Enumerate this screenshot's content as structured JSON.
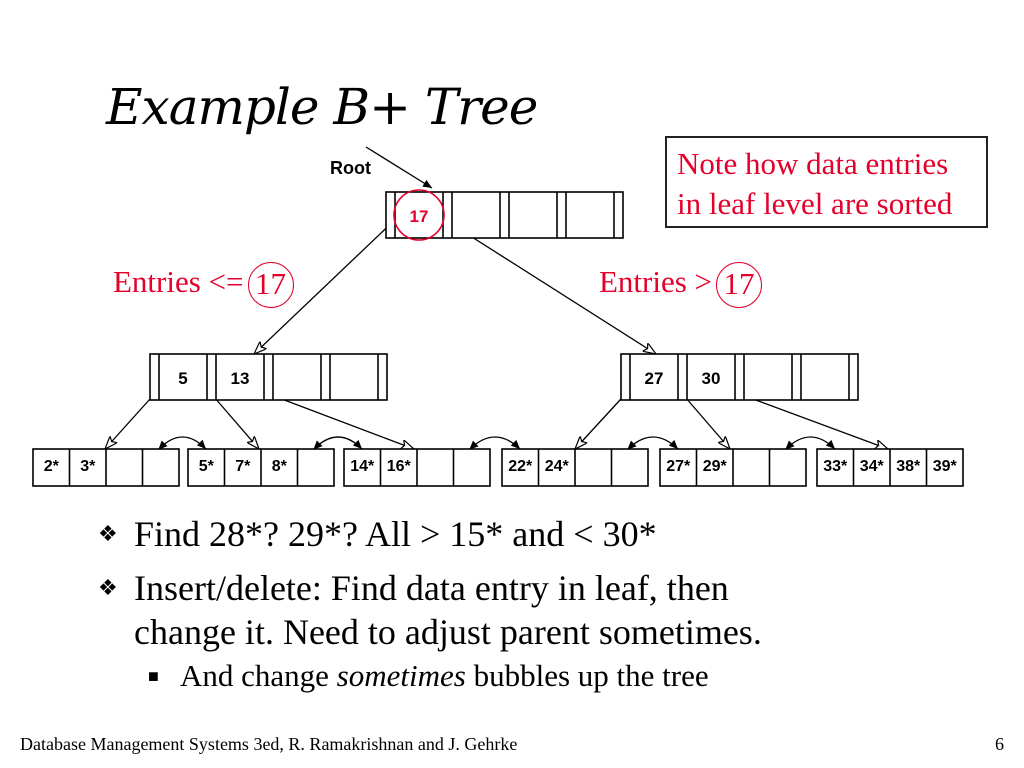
{
  "slide": {
    "title": "Example B+ Tree",
    "note_lines": [
      "Note how data entries",
      "in leaf level are sorted"
    ],
    "root_label": "Root",
    "entries_left": {
      "text": "Entries <=",
      "key": "17"
    },
    "entries_right": {
      "text": "Entries >",
      "key": "17"
    },
    "colors": {
      "accent": "#e4002b",
      "line": "#000000"
    }
  },
  "tree": {
    "root": {
      "keys": [
        "17",
        "",
        "",
        ""
      ],
      "highlighted_key": "17"
    },
    "inner_nodes": [
      {
        "keys": [
          "5",
          "13",
          "",
          ""
        ]
      },
      {
        "keys": [
          "27",
          "30",
          "",
          ""
        ]
      }
    ],
    "leaves": [
      {
        "entries": [
          "2*",
          "3*",
          "",
          ""
        ]
      },
      {
        "entries": [
          "5*",
          "7*",
          "8*",
          ""
        ]
      },
      {
        "entries": [
          "14*",
          "16*",
          "",
          ""
        ]
      },
      {
        "entries": [
          "22*",
          "24*",
          "",
          ""
        ]
      },
      {
        "entries": [
          "27*",
          "29*",
          "",
          ""
        ]
      },
      {
        "entries": [
          "33*",
          "34*",
          "38*",
          "39*"
        ]
      }
    ]
  },
  "bullets": [
    {
      "text": "Find 28*? 29*? All > 15* and < 30*"
    },
    {
      "lines": [
        "Insert/delete:  Find data entry in leaf, then",
        "change it. Need to adjust parent sometimes."
      ]
    }
  ],
  "sub_bullet": {
    "before": "And change ",
    "emphasis": "sometimes",
    "after": " bubbles up the tree"
  },
  "footer": {
    "text": "Database Management Systems 3ed, R. Ramakrishnan and J. Gehrke",
    "page": "6"
  }
}
